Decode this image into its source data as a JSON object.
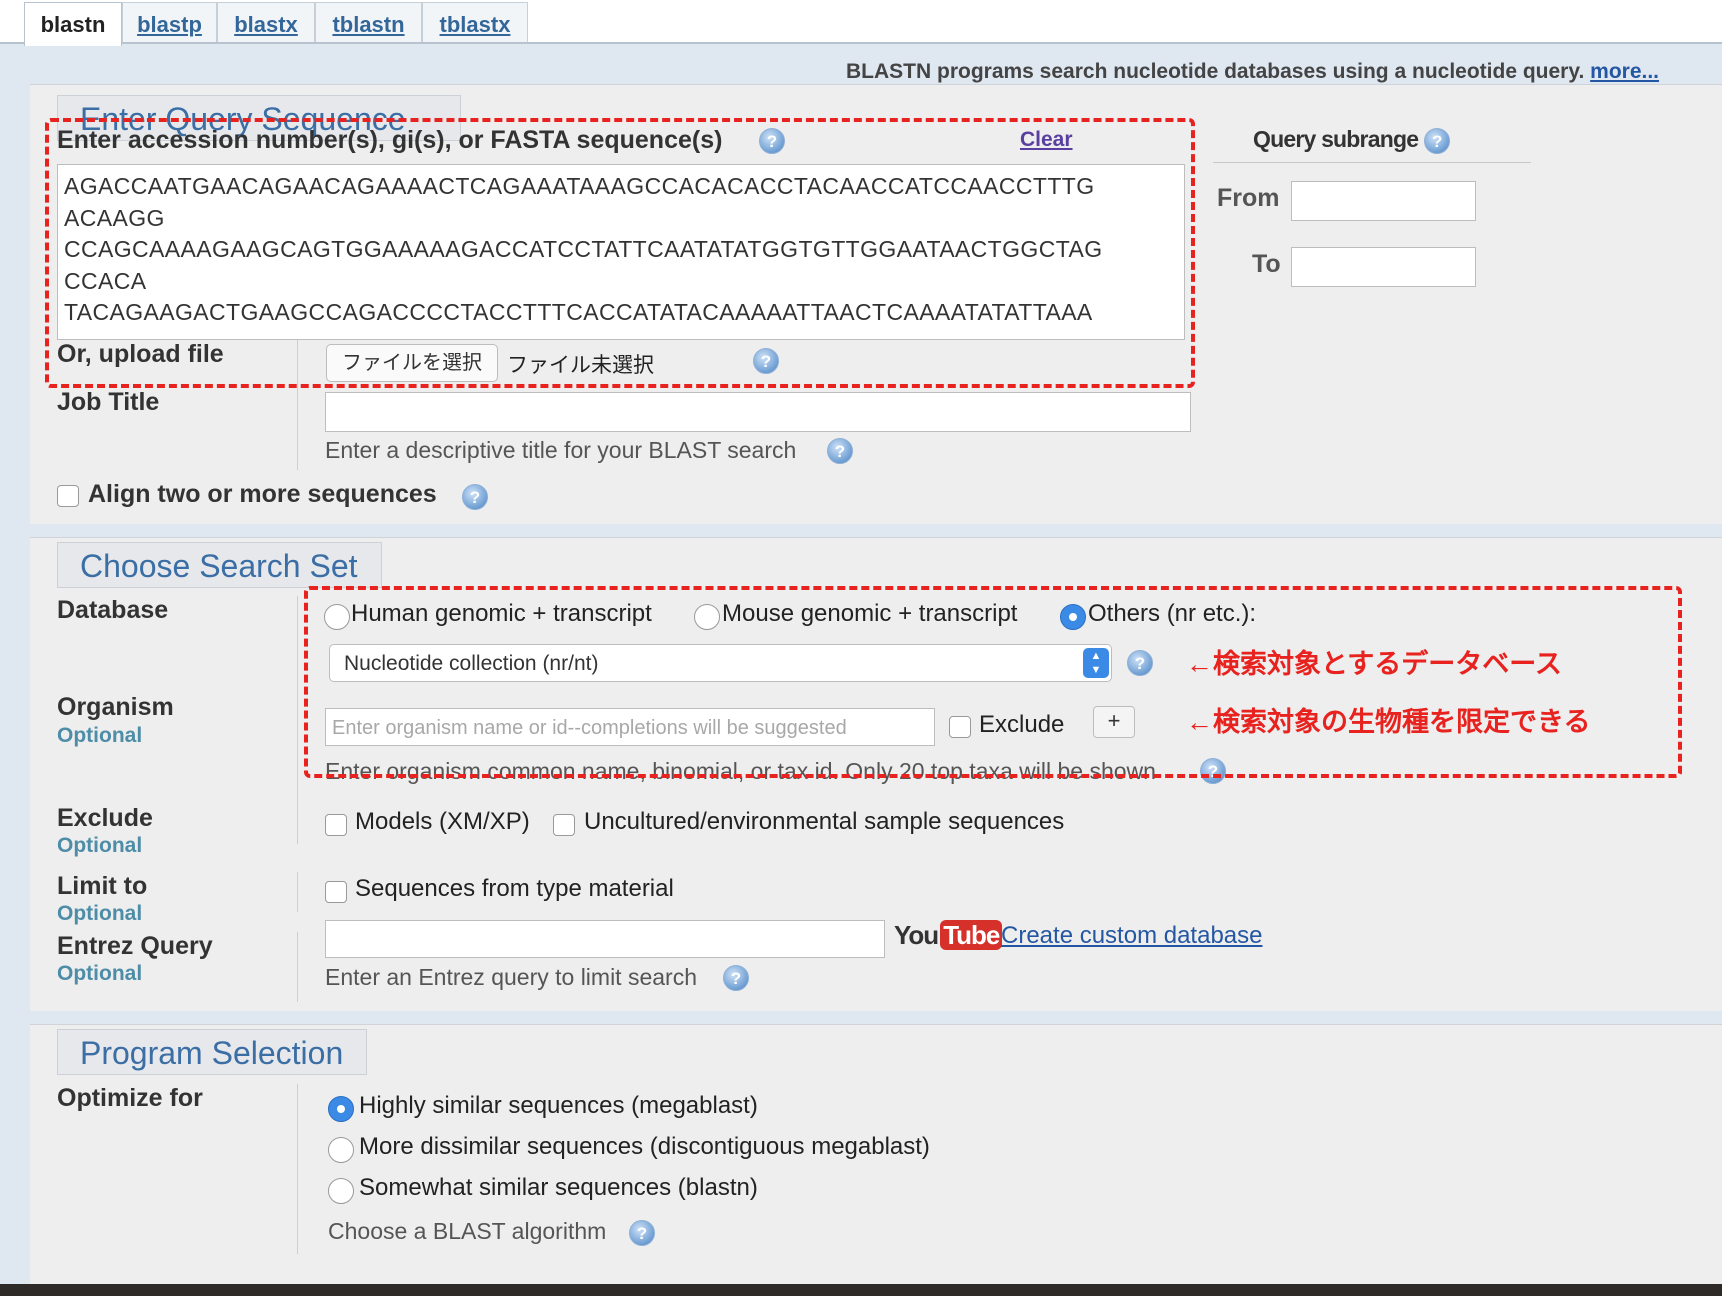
{
  "tabs": [
    "blastn",
    "blastp",
    "blastx",
    "tblastn",
    "tblastx"
  ],
  "header": {
    "description": "BLASTN programs search nucleotide databases using a nucleotide query.",
    "more_link": "more..."
  },
  "query": {
    "section_title": "Enter Query Sequence",
    "accession_label": "Enter accession number(s), gi(s), or FASTA sequence(s)",
    "clear_link": "Clear",
    "sequence_lines": [
      "AGACCAATGAACAGAACAGAAAACTCAGAAATAAAGCCACACACCTACAACCATCCAACCTTTG",
      "ACAAGG",
      "CCAGCAAAAGAAGCAGTGGAAAAAGACCATCCTATTCAATATATGGTGTTGGAATAACTGGCTAG",
      "CCACA",
      "TACAGAAGACTGAAGCCAGACCCCTACCTTTCACCATATACAAAAATTAACTCAAAATATATTAAA"
    ],
    "upload_label": "Or, upload file",
    "file_button": "ファイルを選択",
    "file_status": "ファイル未選択",
    "job_title_label": "Job Title",
    "job_title_hint": "Enter a descriptive title for your BLAST search",
    "align_label": "Align two or more sequences",
    "subrange": {
      "title": "Query subrange",
      "from_label": "From",
      "to_label": "To"
    }
  },
  "search_set": {
    "section_title": "Choose Search Set",
    "database_label": "Database",
    "db_options": [
      "Human genomic + transcript",
      "Mouse genomic + transcript",
      "Others (nr etc.):"
    ],
    "db_selected": "Nucleotide collection (nr/nt)",
    "organism_label": "Organism",
    "optional": "Optional",
    "organism_placeholder": "Enter organism name or id--completions will be suggested",
    "exclude_checkbox": "Exclude",
    "plus_button": "+",
    "organism_hint": "Enter organism common name, binomial, or tax id. Only 20 top taxa will be shown",
    "exclude_label": "Exclude",
    "exclude_models": "Models (XM/XP)",
    "exclude_uncultured": "Uncultured/environmental sample sequences",
    "limit_label": "Limit to",
    "limit_type": "Sequences from type material",
    "entrez_label": "Entrez Query",
    "custom_db_link": "Create custom database",
    "entrez_hint": "Enter an Entrez query to limit search",
    "youtube_you": "You",
    "youtube_tube": "Tube"
  },
  "annotations": {
    "database_note": "←検索対象とするデータベース",
    "organism_note": "←検索対象の生物種を限定できる"
  },
  "program": {
    "section_title": "Program Selection",
    "optimize_label": "Optimize for",
    "options": [
      "Highly similar sequences (megablast)",
      "More dissimilar sequences (discontiguous megablast)",
      "Somewhat similar sequences (blastn)"
    ],
    "hint": "Choose a BLAST algorithm"
  },
  "icons": {
    "help": "help-question-icon"
  },
  "colors": {
    "annotation": "#e8231f",
    "section_title": "#3a6ea5",
    "link": "#2457a3"
  }
}
